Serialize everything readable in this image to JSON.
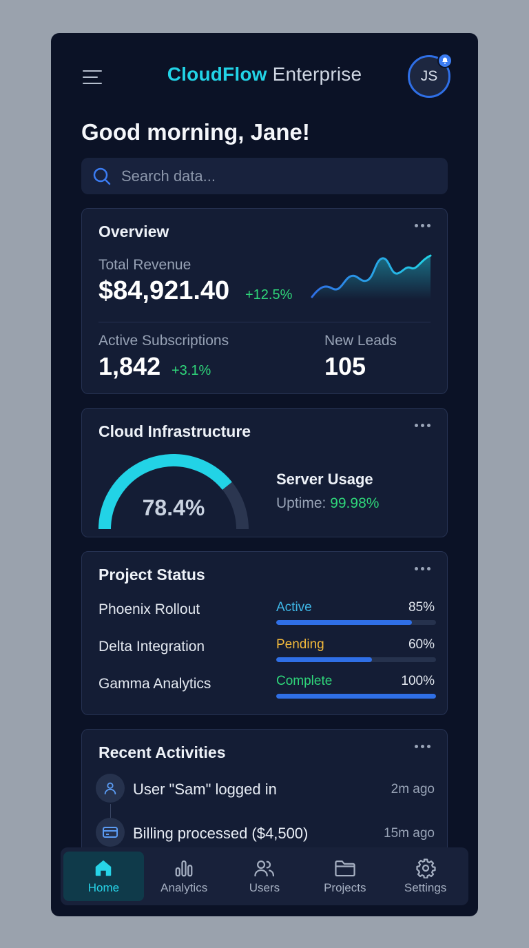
{
  "header": {
    "brand": "CloudFlow",
    "title_suffix": "Enterprise",
    "avatar_initials": "JS"
  },
  "greeting": "Good morning, Jane!",
  "search": {
    "placeholder": "Search data..."
  },
  "overview": {
    "title": "Overview",
    "revenue_label": "Total Revenue",
    "revenue_value": "$84,921.40",
    "revenue_change": "+12.5%",
    "subs_label": "Active Subscriptions",
    "subs_value": "1,842",
    "subs_change": "+3.1%",
    "leads_label": "New Leads",
    "leads_value": "105"
  },
  "infrastructure": {
    "title": "Cloud Infrastructure",
    "gauge_value": "78.4%",
    "gauge_fraction": 0.784,
    "usage_label": "Server Usage",
    "uptime_label": "Uptime:",
    "uptime_value": "99.98%"
  },
  "projects": {
    "title": "Project Status",
    "items": [
      {
        "name": "Phoenix Rollout",
        "status": "Active",
        "status_color": "#3fb8e8",
        "percent": "85%",
        "progress": 0.85
      },
      {
        "name": "Delta Integration",
        "status": "Pending",
        "status_color": "#f2b93b",
        "percent": "60%",
        "progress": 0.6
      },
      {
        "name": "Gamma Analytics",
        "status": "Complete",
        "status_color": "#2fd67a",
        "percent": "100%",
        "progress": 1.0
      }
    ]
  },
  "activities": {
    "title": "Recent Activities",
    "items": [
      {
        "text": "User \"Sam\" logged in",
        "time": "2m ago",
        "icon": "user-icon"
      },
      {
        "text": "Billing processed ($4,500)",
        "time": "15m ago",
        "icon": "credit-card-icon"
      }
    ]
  },
  "nav": {
    "items": [
      {
        "label": "Home",
        "icon": "home-icon",
        "active": true
      },
      {
        "label": "Analytics",
        "icon": "bar-chart-icon",
        "active": false
      },
      {
        "label": "Users",
        "icon": "users-icon",
        "active": false
      },
      {
        "label": "Projects",
        "icon": "folder-icon",
        "active": false
      },
      {
        "label": "Settings",
        "icon": "gear-icon",
        "active": false
      }
    ]
  },
  "colors": {
    "accent": "#22d3e6",
    "primary": "#2f6fe6",
    "positive": "#2fd67a",
    "background": "#0b1226",
    "card": "#141d35"
  }
}
